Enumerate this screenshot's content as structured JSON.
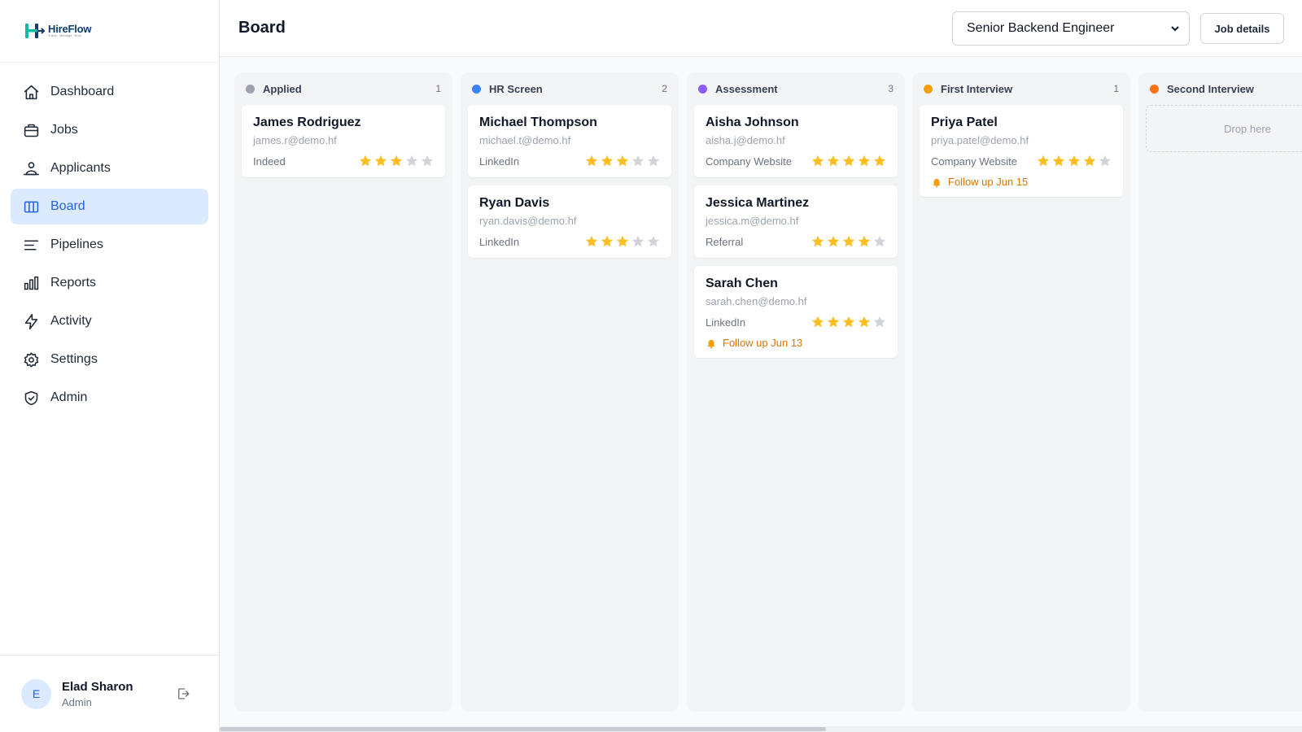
{
  "brand": {
    "name": "HireFlow",
    "tagline": "Track. Manage. Hire."
  },
  "sidebar": {
    "items": [
      {
        "label": "Dashboard",
        "icon": "home-icon",
        "active": false
      },
      {
        "label": "Jobs",
        "icon": "briefcase-icon",
        "active": false
      },
      {
        "label": "Applicants",
        "icon": "users-icon",
        "active": false
      },
      {
        "label": "Board",
        "icon": "columns-icon",
        "active": true
      },
      {
        "label": "Pipelines",
        "icon": "lines-icon",
        "active": false
      },
      {
        "label": "Reports",
        "icon": "bar-chart-icon",
        "active": false
      },
      {
        "label": "Activity",
        "icon": "zap-icon",
        "active": false
      },
      {
        "label": "Settings",
        "icon": "gear-icon",
        "active": false
      },
      {
        "label": "Admin",
        "icon": "shield-icon",
        "active": false
      }
    ],
    "user": {
      "initial": "E",
      "name": "Elad Sharon",
      "role": "Admin"
    }
  },
  "header": {
    "title": "Board",
    "job_select": {
      "value": "Senior Backend Engineer"
    },
    "job_details_label": "Job details"
  },
  "board": {
    "columns": [
      {
        "title": "Applied",
        "count": "1",
        "color": "#9ca3af",
        "cards": [
          {
            "name": "James Rodriguez",
            "email": "james.r@demo.hf",
            "source": "Indeed",
            "rating": 3
          }
        ]
      },
      {
        "title": "HR Screen",
        "count": "2",
        "color": "#3b82f6",
        "cards": [
          {
            "name": "Michael Thompson",
            "email": "michael.t@demo.hf",
            "source": "LinkedIn",
            "rating": 3
          },
          {
            "name": "Ryan Davis",
            "email": "ryan.davis@demo.hf",
            "source": "LinkedIn",
            "rating": 3
          }
        ]
      },
      {
        "title": "Assessment",
        "count": "3",
        "color": "#8b5cf6",
        "cards": [
          {
            "name": "Aisha Johnson",
            "email": "aisha.j@demo.hf",
            "source": "Company Website",
            "rating": 5
          },
          {
            "name": "Jessica Martinez",
            "email": "jessica.m@demo.hf",
            "source": "Referral",
            "rating": 4
          },
          {
            "name": "Sarah Chen",
            "email": "sarah.chen@demo.hf",
            "source": "LinkedIn",
            "rating": 4,
            "followup": "Follow up Jun 13"
          }
        ]
      },
      {
        "title": "First Interview",
        "count": "1",
        "color": "#f59e0b",
        "cards": [
          {
            "name": "Priya Patel",
            "email": "priya.patel@demo.hf",
            "source": "Company Website",
            "rating": 4,
            "followup": "Follow up Jun 15"
          }
        ]
      },
      {
        "title": "Second Interview",
        "count": "",
        "color": "#f97316",
        "cards": [],
        "drop_text": "Drop here"
      }
    ]
  },
  "colors": {
    "accent": "#2563eb",
    "star_on": "#fbbf24",
    "star_off": "#d1d5db",
    "followup": "#d97706"
  }
}
